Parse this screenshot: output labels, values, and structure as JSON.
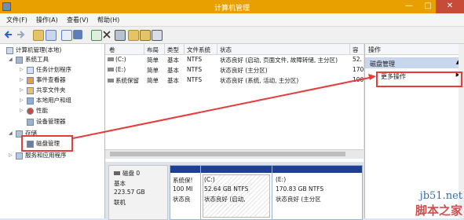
{
  "window": {
    "title": "计算机管理",
    "min": "—",
    "max": "□",
    "close": "✕"
  },
  "menu": [
    "文件(F)",
    "操作(A)",
    "查看(V)",
    "帮助(H)"
  ],
  "tree": {
    "root": "计算机管理(本地)",
    "system_tools": "系统工具",
    "items": [
      "任务计划程序",
      "事件查看器",
      "共享文件夹",
      "本地用户和组",
      "性能",
      "设备管理器"
    ],
    "storage": "存储",
    "disk_mgmt": "磁盘管理",
    "services": "服务和应用程序"
  },
  "table": {
    "headers": [
      "卷",
      "布局",
      "类型",
      "文件系统",
      "状态",
      "容"
    ],
    "rows": [
      [
        "(C:)",
        "简单",
        "基本",
        "NTFS",
        "状态良好 (启动, 页面文件, 故障转储, 主分区)",
        "52."
      ],
      [
        "(E:)",
        "简单",
        "基本",
        "NTFS",
        "状态良好 (主分区)",
        "170"
      ],
      [
        "系统保留",
        "简单",
        "基本",
        "NTFS",
        "状态良好 (系统, 活动, 主分区)",
        "100"
      ]
    ]
  },
  "disk": {
    "name": "磁盘 0",
    "type": "基本",
    "size": "223.57 GB",
    "status": "联机",
    "partitions": [
      {
        "name": "系统保!",
        "line2": "100 MI",
        "line3": "状态良"
      },
      {
        "name": "(C:)",
        "line2": "52.64 GB NTFS",
        "line3": "状态良好 (启动,"
      },
      {
        "name": "(E:)",
        "line2": "170.83 GB NTFS",
        "line3": "状态良好 (主分区"
      }
    ]
  },
  "actions": {
    "header": "操作",
    "section": "磁盘管理",
    "more": "更多操作"
  },
  "watermark": {
    "line1": "jb51.net",
    "line2": "脚本之家"
  },
  "colors": {
    "titlebar": "#e8a000",
    "highlight": "#e63c3c",
    "partition_bar": "#1e3f96"
  }
}
